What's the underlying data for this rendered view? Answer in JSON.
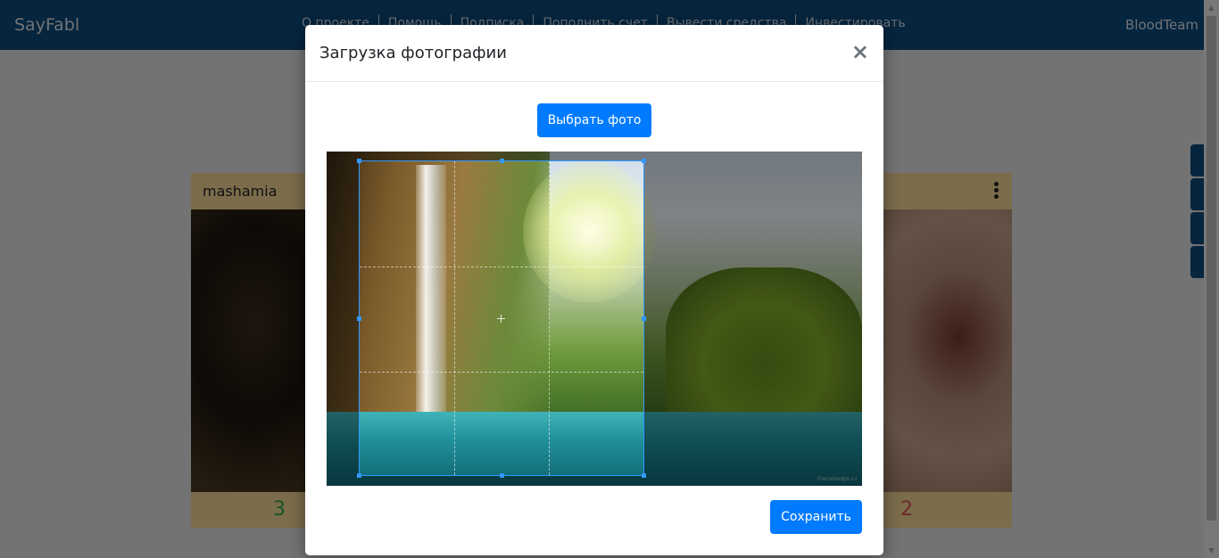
{
  "app": {
    "brand": "SayFabl",
    "user": "BloodTeam"
  },
  "nav": {
    "items": [
      {
        "label": "О проекте"
      },
      {
        "label": "Помощь"
      },
      {
        "label": "Подписка"
      },
      {
        "label": "Пополнить счет"
      },
      {
        "label": "Вывести средства"
      },
      {
        "label": "Инвестировать"
      }
    ]
  },
  "cards": {
    "left": {
      "username": "mashamia",
      "likes": "3"
    },
    "right": {
      "dislikes": "2"
    }
  },
  "modal": {
    "title": "Загрузка фотографии",
    "close": "×",
    "choose_label": "Выбрать фото",
    "save_label": "Сохранить",
    "photo_watermark": "©ecoloodps.ru"
  },
  "icons": {
    "like": "thumbs-up-icon",
    "dislike": "thumbs-down-icon",
    "menu": "more-vertical-icon",
    "close": "close-icon",
    "side": [
      "user-icon",
      "thumbs-up-icon",
      "cart-icon",
      "circle-icon"
    ]
  },
  "colors": {
    "nav": "#0d4a7c",
    "primary": "#007bff",
    "card": "#f6d897",
    "like": "#2ea44f",
    "dislike": "#d9534f",
    "crop": "#3399ff"
  }
}
